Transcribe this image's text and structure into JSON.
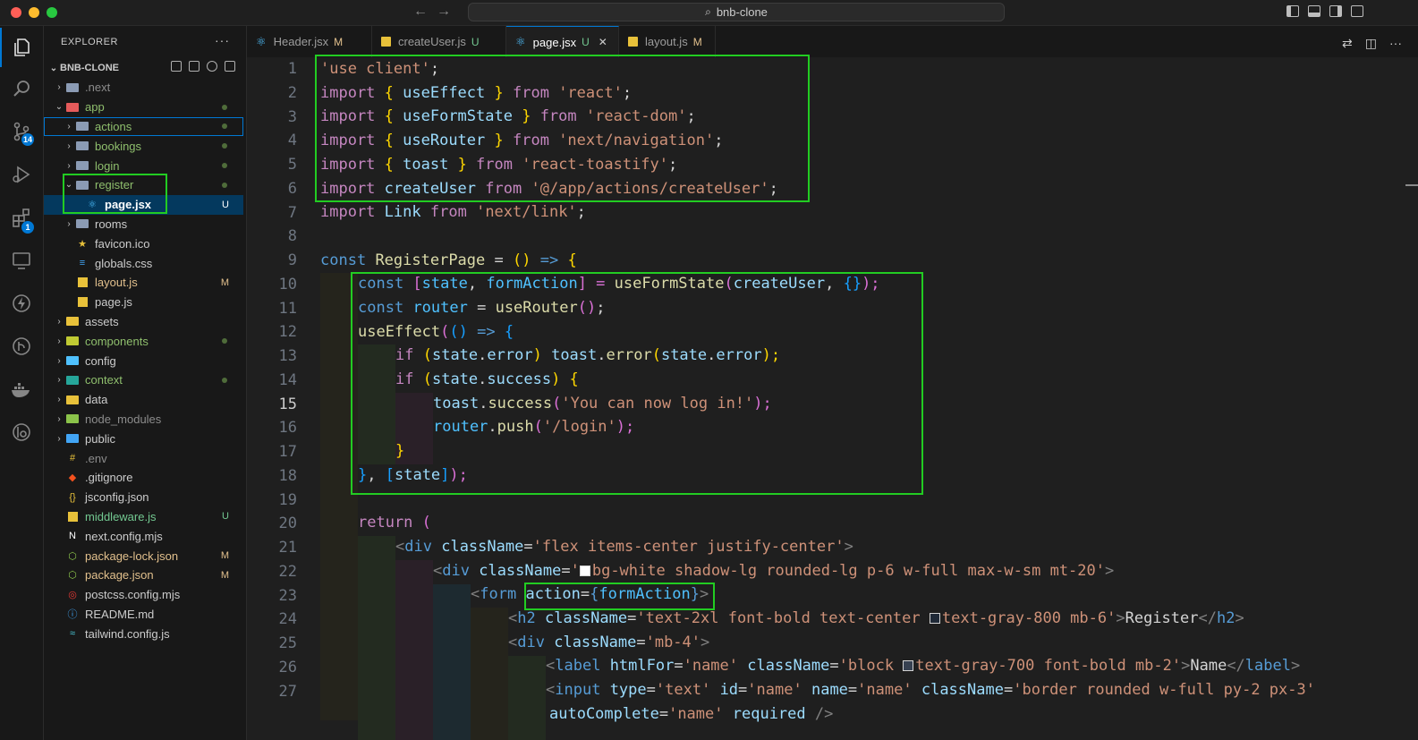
{
  "window": {
    "search_text": "bnb-clone"
  },
  "activity_bar": {
    "source_control_badge": "14",
    "extensions_badge": "1"
  },
  "sidebar": {
    "title": "EXPLORER",
    "more": "···",
    "root": "BNB-CLONE",
    "items": [
      {
        "label": ".next",
        "type": "folder",
        "depth": 1,
        "expanded": false,
        "status": "",
        "color": "#8b9bb4"
      },
      {
        "label": "app",
        "type": "folder",
        "depth": 1,
        "expanded": true,
        "status": "dot",
        "color": "#e55b5b"
      },
      {
        "label": "actions",
        "type": "folder",
        "depth": 2,
        "expanded": false,
        "status": "dot",
        "color": "#8b9bb4"
      },
      {
        "label": "bookings",
        "type": "folder",
        "depth": 2,
        "expanded": false,
        "status": "dot",
        "color": "#8b9bb4"
      },
      {
        "label": "login",
        "type": "folder",
        "depth": 2,
        "expanded": false,
        "status": "dot",
        "color": "#8b9bb4"
      },
      {
        "label": "register",
        "type": "folder",
        "depth": 2,
        "expanded": true,
        "status": "dot",
        "color": "#8b9bb4"
      },
      {
        "label": "page.jsx",
        "type": "react",
        "depth": 3,
        "expanded": null,
        "status": "U",
        "color": "#4fc1ff"
      },
      {
        "label": "rooms",
        "type": "folder",
        "depth": 2,
        "expanded": false,
        "status": "",
        "color": "#8b9bb4"
      },
      {
        "label": "favicon.ico",
        "type": "star",
        "depth": 2,
        "expanded": null,
        "status": "",
        "color": "#e8c13a"
      },
      {
        "label": "globals.css",
        "type": "css",
        "depth": 2,
        "expanded": null,
        "status": "",
        "color": "#42a5f5"
      },
      {
        "label": "layout.js",
        "type": "js",
        "depth": 2,
        "expanded": null,
        "status": "M",
        "color": "#e8c13a"
      },
      {
        "label": "page.js",
        "type": "js",
        "depth": 2,
        "expanded": null,
        "status": "",
        "color": "#e8c13a"
      },
      {
        "label": "assets",
        "type": "folder",
        "depth": 1,
        "expanded": false,
        "status": "",
        "color": "#e8c13a"
      },
      {
        "label": "components",
        "type": "folder",
        "depth": 1,
        "expanded": false,
        "status": "dot",
        "color": "#c0ca33"
      },
      {
        "label": "config",
        "type": "folder",
        "depth": 1,
        "expanded": false,
        "status": "",
        "color": "#4fc1ff"
      },
      {
        "label": "context",
        "type": "folder",
        "depth": 1,
        "expanded": false,
        "status": "dot",
        "color": "#26a69a"
      },
      {
        "label": "data",
        "type": "folder",
        "depth": 1,
        "expanded": false,
        "status": "",
        "color": "#e8c13a"
      },
      {
        "label": "node_modules",
        "type": "folder",
        "depth": 1,
        "expanded": false,
        "status": "",
        "color": "#8bc34a"
      },
      {
        "label": "public",
        "type": "folder",
        "depth": 1,
        "expanded": false,
        "status": "",
        "color": "#42a5f5"
      },
      {
        "label": ".env",
        "type": "env",
        "depth": 1,
        "expanded": null,
        "status": "",
        "color": "#e8c13a"
      },
      {
        "label": ".gitignore",
        "type": "git",
        "depth": 1,
        "expanded": null,
        "status": "",
        "color": "#f4511e"
      },
      {
        "label": "jsconfig.json",
        "type": "json",
        "depth": 1,
        "expanded": null,
        "status": "",
        "color": "#e8c13a"
      },
      {
        "label": "middleware.js",
        "type": "js",
        "depth": 1,
        "expanded": null,
        "status": "U",
        "color": "#e8c13a"
      },
      {
        "label": "next.config.mjs",
        "type": "next",
        "depth": 1,
        "expanded": null,
        "status": "",
        "color": "#ffffff"
      },
      {
        "label": "package-lock.json",
        "type": "node",
        "depth": 1,
        "expanded": null,
        "status": "M",
        "color": "#8bc34a"
      },
      {
        "label": "package.json",
        "type": "node",
        "depth": 1,
        "expanded": null,
        "status": "M",
        "color": "#8bc34a"
      },
      {
        "label": "postcss.config.mjs",
        "type": "postcss",
        "depth": 1,
        "expanded": null,
        "status": "",
        "color": "#e53935"
      },
      {
        "label": "README.md",
        "type": "info",
        "depth": 1,
        "expanded": null,
        "status": "",
        "color": "#42a5f5"
      },
      {
        "label": "tailwind.config.js",
        "type": "tailwind",
        "depth": 1,
        "expanded": null,
        "status": "",
        "color": "#4dd0e1"
      }
    ]
  },
  "tabs": [
    {
      "label": "Header.jsx",
      "status": "M",
      "icon": "react",
      "active": false
    },
    {
      "label": "createUser.js",
      "status": "U",
      "icon": "js",
      "active": false
    },
    {
      "label": "page.jsx",
      "status": "U",
      "icon": "react",
      "active": true
    },
    {
      "label": "layout.js",
      "status": "M",
      "icon": "js",
      "active": false
    }
  ],
  "editor": {
    "current_line": 15,
    "line_numbers": [
      "1",
      "2",
      "3",
      "4",
      "5",
      "6",
      "7",
      "8",
      "9",
      "10",
      "11",
      "12",
      "13",
      "14",
      "15",
      "16",
      "17",
      "18",
      "19",
      "20",
      "21",
      "22",
      "23",
      "24",
      "25",
      "26",
      "27"
    ]
  },
  "code": {
    "l1": {
      "a": "'use client'",
      "b": ";"
    },
    "l2": {
      "a": "import",
      "b": " { ",
      "c": "useEffect",
      "d": " } ",
      "e": "from",
      "f": " ",
      "g": "'react'",
      "h": ";"
    },
    "l3": {
      "a": "import",
      "b": " { ",
      "c": "useFormState",
      "d": " } ",
      "e": "from",
      "f": " ",
      "g": "'react-dom'",
      "h": ";"
    },
    "l4": {
      "a": "import",
      "b": " { ",
      "c": "useRouter",
      "d": " } ",
      "e": "from",
      "f": " ",
      "g": "'next/navigation'",
      "h": ";"
    },
    "l5": {
      "a": "import",
      "b": " { ",
      "c": "toast",
      "d": " } ",
      "e": "from",
      "f": " ",
      "g": "'react-toastify'",
      "h": ";"
    },
    "l6": {
      "a": "import",
      "b": " ",
      "c": "createUser",
      "d": " ",
      "e": "from",
      "f": " ",
      "g": "'@/app/actions/createUser'",
      "h": ";"
    },
    "l7": {
      "a": "import",
      "b": " ",
      "c": "Link",
      "d": " ",
      "e": "from",
      "f": " ",
      "g": "'next/link'",
      "h": ";"
    },
    "l9": {
      "a": "const",
      "b": " ",
      "c": "RegisterPage",
      "d": " = ",
      "e": "()",
      "f": " ",
      "g": "=>",
      "h": " ",
      "i": "{"
    },
    "l10": {
      "a": "const",
      "b": " [",
      "c": "state",
      "d": ", ",
      "e": "formAction",
      "f": "] = ",
      "g": "useFormState",
      "h": "(",
      "i": "createUser",
      "j": ", ",
      "k": "{}",
      "l": ");"
    },
    "l11": {
      "a": "const",
      "b": " ",
      "c": "router",
      "d": " = ",
      "e": "useRouter",
      "f": "()",
      "g": ";"
    },
    "l12": {
      "a": "useEffect",
      "b": "(",
      "c": "()",
      "d": " ",
      "e": "=>",
      "f": " ",
      "g": "{"
    },
    "l13": {
      "a": "if",
      "b": " (",
      "c": "state",
      "d": ".",
      "e": "error",
      "f": ") ",
      "g": "toast",
      "h": ".",
      "i": "error",
      "j": "(",
      "k": "state",
      "l": ".",
      "m": "error",
      "n": ");"
    },
    "l14": {
      "a": "if",
      "b": " (",
      "c": "state",
      "d": ".",
      "e": "success",
      "f": ") ",
      "g": "{"
    },
    "l15": {
      "a": "toast",
      "b": ".",
      "c": "success",
      "d": "(",
      "e": "'You can now log in!'",
      "f": ");"
    },
    "l16": {
      "a": "router",
      "b": ".",
      "c": "push",
      "d": "(",
      "e": "'/login'",
      "f": ");"
    },
    "l17": {
      "a": "}"
    },
    "l18": {
      "a": "}",
      "b": ", ",
      "c": "[",
      "d": "state",
      "e": "]",
      "f": ");"
    },
    "l20": {
      "a": "return",
      "b": " ",
      "c": "("
    },
    "l21": {
      "a": "<",
      "b": "div",
      "c": " ",
      "d": "className",
      "e": "=",
      "f": "'flex items-center justify-center'",
      "g": ">"
    },
    "l22": {
      "a": "<",
      "b": "div",
      "c": " ",
      "d": "className",
      "e": "=",
      "f": "'",
      "g": "bg-white shadow-lg rounded-lg p-6 w-full max-w-sm mt-20'",
      "h": ">"
    },
    "l23": {
      "a": "<",
      "b": "form",
      "c": " ",
      "d": "action",
      "e": "=",
      "f": "{",
      "g": "formAction",
      "h": "}",
      "i": ">"
    },
    "l24": {
      "a": "<",
      "b": "h2",
      "c": " ",
      "d": "className",
      "e": "=",
      "f": "'text-2xl font-bold text-center ",
      "g": "text-gray-800 mb-6'",
      "h": ">",
      "i": "Register",
      "j": "</",
      "k": "h2",
      "l": ">"
    },
    "l25": {
      "a": "<",
      "b": "div",
      "c": " ",
      "d": "className",
      "e": "=",
      "f": "'mb-4'",
      "g": ">"
    },
    "l26": {
      "a": "<",
      "b": "label",
      "c": " ",
      "d": "htmlFor",
      "e": "=",
      "f": "'name'",
      "g": " ",
      "h": "className",
      "i": "=",
      "j": "'block ",
      "k": "text-gray-700 font-bold mb-2'",
      "l": ">",
      "m": "Name",
      "n": "</",
      "o": "label",
      "p": ">"
    },
    "l27": {
      "a": "<",
      "b": "input",
      "c": " ",
      "d": "type",
      "e": "=",
      "f": "'text'",
      "g": " ",
      "h": "id",
      "i": "=",
      "j": "'name'",
      "k": " ",
      "l": "name",
      "m": "=",
      "n": "'name'",
      "o": " ",
      "p": "className",
      "q": "=",
      "r": "'border rounded w-full py-2 px-3'"
    },
    "l27b": {
      "a": "autoComplete",
      "b": "=",
      "c": "'name'",
      "d": " ",
      "e": "required",
      "f": " ",
      "g": "/>"
    }
  }
}
